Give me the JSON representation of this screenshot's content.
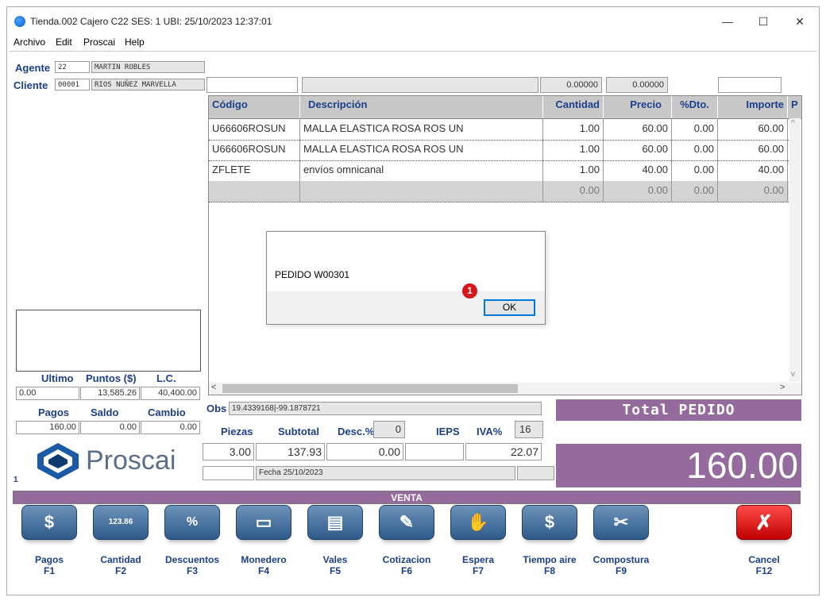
{
  "window": {
    "title": "Tienda.002  Cajero C22    SES: 1   UBI:   25/10/2023 12:37:01",
    "minimize": "—",
    "maximize": "☐",
    "close": "✕"
  },
  "menu": [
    "Archivo",
    "Edit",
    "Proscai",
    "Help"
  ],
  "agent": {
    "label": "Agente",
    "code": "22",
    "name": "MARTIN ROBLES"
  },
  "client": {
    "label": "Cliente",
    "code": "00001",
    "name": "RIOS NUÑEZ MARVELLA"
  },
  "entry_row": {
    "val1": "0.00000",
    "val2": "0.00000"
  },
  "grid": {
    "headers": [
      "Código",
      "Descripción",
      "Cantidad",
      "Precio",
      "%Dto.",
      "Importe",
      "P"
    ],
    "rows": [
      [
        "U66606ROSUN",
        "MALLA ELASTICA ROSA ROS UN",
        "1.00",
        "60.00",
        "0.00",
        "60.00"
      ],
      [
        "U66606ROSUN",
        "MALLA ELASTICA ROSA ROS UN",
        "1.00",
        "60.00",
        "0.00",
        "60.00"
      ],
      [
        "ZFLETE",
        "envíos omnicanal",
        "1.00",
        "40.00",
        "0.00",
        "40.00"
      ],
      [
        "",
        "",
        "0.00",
        "0.00",
        "0.00",
        "0.00"
      ]
    ]
  },
  "dialog": {
    "message": "PEDIDO W00301",
    "ok": "OK",
    "badge": "1"
  },
  "credit": {
    "labels": [
      "Ultimo",
      "Puntos ($)",
      "L.C."
    ],
    "values": [
      "0.00",
      "13,585.26",
      "40,400.00"
    ]
  },
  "payments": {
    "labels": [
      "Pagos",
      "Saldo",
      "Cambio"
    ],
    "values": [
      "160.00",
      "0.00",
      "0.00"
    ]
  },
  "obs": {
    "label": "Obs",
    "value": "19.4339168|-99.1878721"
  },
  "totals": {
    "labels": [
      "Piezas",
      "Subtotal",
      "Desc.%",
      "IEPS",
      "IVA%"
    ],
    "desc_pct": "0",
    "iva_pct": "16",
    "piezas": "3.00",
    "subtotal": "137.93",
    "desc": "0.00",
    "iva": "22.07",
    "fecha": "Fecha 25/10/2023"
  },
  "logo": {
    "text": "Proscai",
    "counter": "1"
  },
  "total": {
    "label": "Total PEDIDO",
    "value": "160.00"
  },
  "mode": "VENTA",
  "fkeys": [
    {
      "label": "Pagos",
      "key": "F1",
      "icon": "$"
    },
    {
      "label": "Cantidad",
      "key": "F2",
      "icon": "123.86"
    },
    {
      "label": "Descuentos",
      "key": "F3",
      "icon": "%"
    },
    {
      "label": "Monedero",
      "key": "F4",
      "icon": "▭"
    },
    {
      "label": "Vales",
      "key": "F5",
      "icon": "▤"
    },
    {
      "label": "Cotizacion",
      "key": "F6",
      "icon": "✎"
    },
    {
      "label": "Espera",
      "key": "F7",
      "icon": "✋"
    },
    {
      "label": "Tiempo aire",
      "key": "F8",
      "icon": "$"
    },
    {
      "label": "Compostura",
      "key": "F9",
      "icon": "✂"
    },
    {
      "label": "Cancel",
      "key": "F12",
      "icon": "✗"
    }
  ],
  "colors": {
    "accent": "#956a9c",
    "label_blue": "#1c3f8c",
    "button_blue": "#2e5a8a",
    "cancel_red": "#c00000"
  }
}
